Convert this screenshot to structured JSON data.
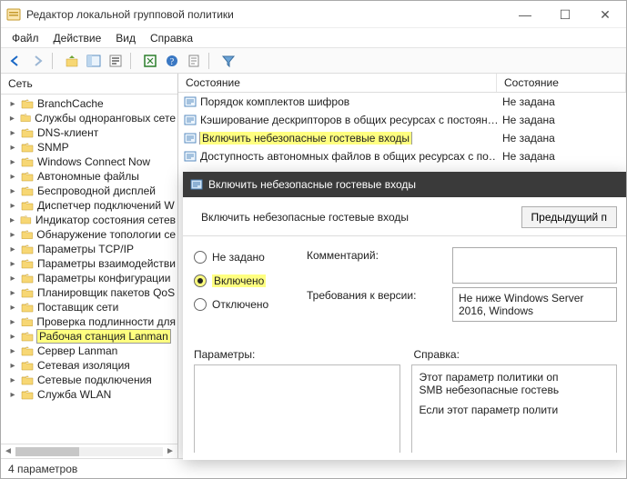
{
  "window": {
    "title": "Редактор локальной групповой политики"
  },
  "menu": {
    "file": "Файл",
    "action": "Действие",
    "view": "Вид",
    "help": "Справка"
  },
  "tree": {
    "root": "Сеть",
    "items": [
      "BranchCache",
      "Службы одноранговых сете",
      "DNS-клиент",
      "SNMP",
      "Windows Connect Now",
      "Автономные файлы",
      "Беспроводной дисплей",
      "Диспетчер подключений W",
      "Индикатор состояния сетев",
      "Обнаружение топологии се",
      "Параметры TCP/IP",
      "Параметры взаимодействи",
      "Параметры конфигурации",
      "Планировщик пакетов QoS",
      "Поставщик сети",
      "Проверка подлинности для",
      "Рабочая станция Lanman",
      "Сервер Lanman",
      "Сетевая изоляция",
      "Сетевые подключения",
      "Служба WLAN"
    ],
    "selected_index": 16
  },
  "list": {
    "col_state": "Состояние",
    "col_status": "Состояние",
    "rows": [
      {
        "label": "Порядок комплектов шифров",
        "value": "Не задана"
      },
      {
        "label": "Кэширование дескрипторов в общих ресурсах с постоян…",
        "value": "Не задана"
      },
      {
        "label": "Включить небезопасные гостевые входы",
        "value": "Не задана"
      },
      {
        "label": "Доступность автономных файлов в общих ресурсах с по…",
        "value": "Не задана"
      }
    ],
    "highlight_index": 2
  },
  "dialog": {
    "title": "Включить небезопасные гостевые входы",
    "subtitle": "Включить небезопасные гостевые входы",
    "prev_button": "Предыдущий п",
    "radio_not_set": "Не задано",
    "radio_enabled": "Включено",
    "radio_disabled": "Отключено",
    "comment_label": "Комментарий:",
    "requirements_label": "Требования к версии:",
    "requirements_value": "Не ниже Windows Server 2016, Windows",
    "params_header": "Параметры:",
    "help_header": "Справка:",
    "help_text_1": "Этот параметр политики оп",
    "help_text_2": "SMB небезопасные гостевь",
    "help_text_3": "Если этот параметр полити"
  },
  "statusbar": {
    "text": "4 параметров"
  }
}
